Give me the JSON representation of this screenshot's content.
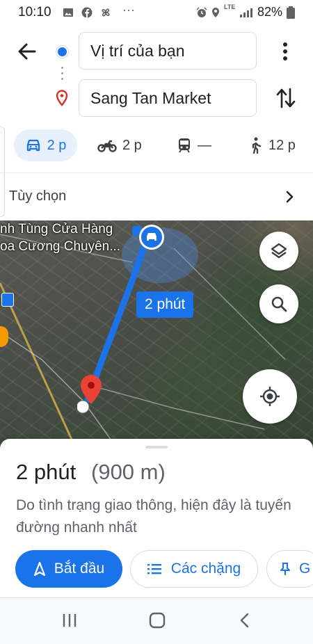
{
  "status_bar": {
    "time": "10:10",
    "more": "···",
    "network": "LTE",
    "battery": "82%"
  },
  "route": {
    "origin": "Vị trí của bạn",
    "destination": "Sang Tan Market"
  },
  "modes": [
    {
      "icon": "car-icon",
      "label": "2 p",
      "active": true
    },
    {
      "icon": "motorbike-icon",
      "label": "2 p",
      "active": false
    },
    {
      "icon": "transit-icon",
      "label": "—",
      "active": false
    },
    {
      "icon": "walk-icon",
      "label": "12 p",
      "active": false
    }
  ],
  "options": {
    "label": "Tùy chọn"
  },
  "map": {
    "place_line1": "nh Tùng Cửa Hàng",
    "place_line2": "oa Cương Chuyên...",
    "route_time": "2 phút",
    "route_color": "#1a73e8"
  },
  "summary": {
    "duration": "2 phút",
    "distance": "(900 m)",
    "note": "Do tình trạng giao thông, hiện đây là tuyến đường nhanh nhất"
  },
  "actions": {
    "start": "Bắt đầu",
    "steps": "Các chặng",
    "pin": "G"
  }
}
